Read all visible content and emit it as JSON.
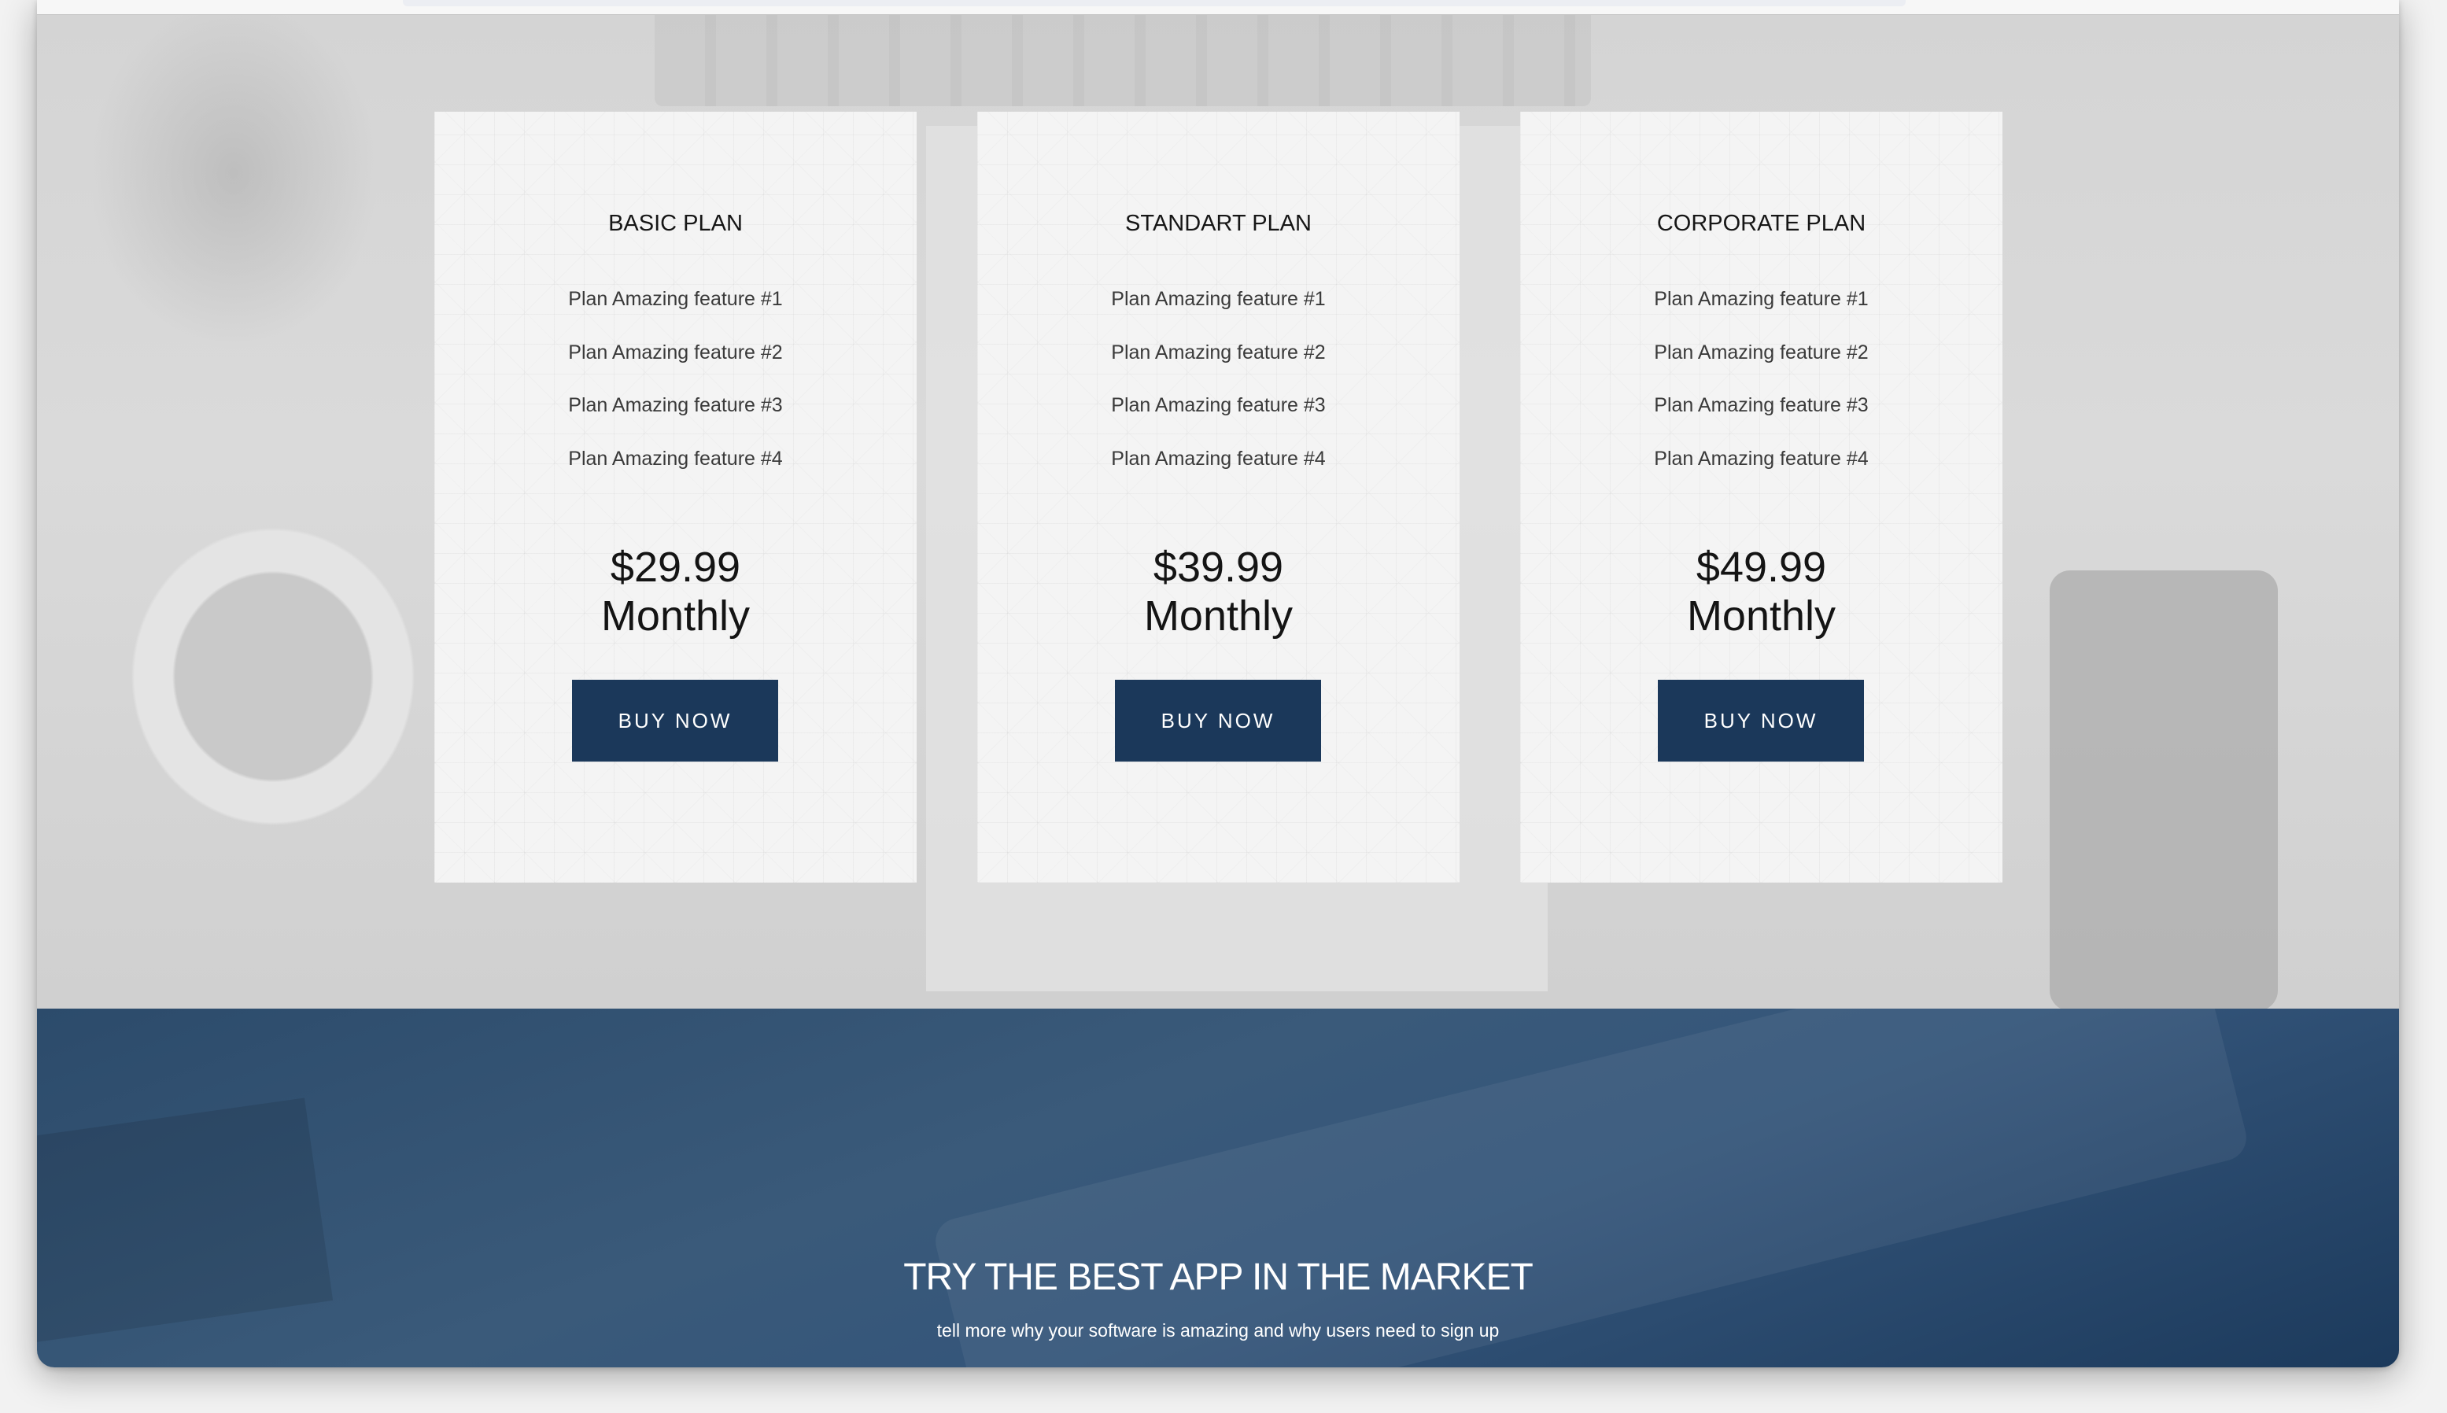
{
  "pricing": {
    "plans": [
      {
        "title": "BASIC PLAN",
        "features": [
          "Plan Amazing feature #1",
          "Plan Amazing feature #2",
          "Plan Amazing feature #3",
          "Plan Amazing feature #4"
        ],
        "price": "$29.99",
        "period": "Monthly",
        "button_label": "BUY NOW"
      },
      {
        "title": "STANDART PLAN",
        "features": [
          "Plan Amazing feature #1",
          "Plan Amazing feature #2",
          "Plan Amazing feature #3",
          "Plan Amazing feature #4"
        ],
        "price": "$39.99",
        "period": "Monthly",
        "button_label": "BUY NOW"
      },
      {
        "title": "CORPORATE PLAN",
        "features": [
          "Plan Amazing feature #1",
          "Plan Amazing feature #2",
          "Plan Amazing feature #3",
          "Plan Amazing feature #4"
        ],
        "price": "$49.99",
        "period": "Monthly",
        "button_label": "BUY NOW"
      }
    ]
  },
  "cta": {
    "title": "TRY THE BEST APP IN THE MARKET",
    "subtitle": "tell more why your software is amazing and why users need to sign up"
  },
  "colors": {
    "accent": "#1b385a",
    "cta_background": "#34557a",
    "card_background": "#f4f4f4"
  }
}
